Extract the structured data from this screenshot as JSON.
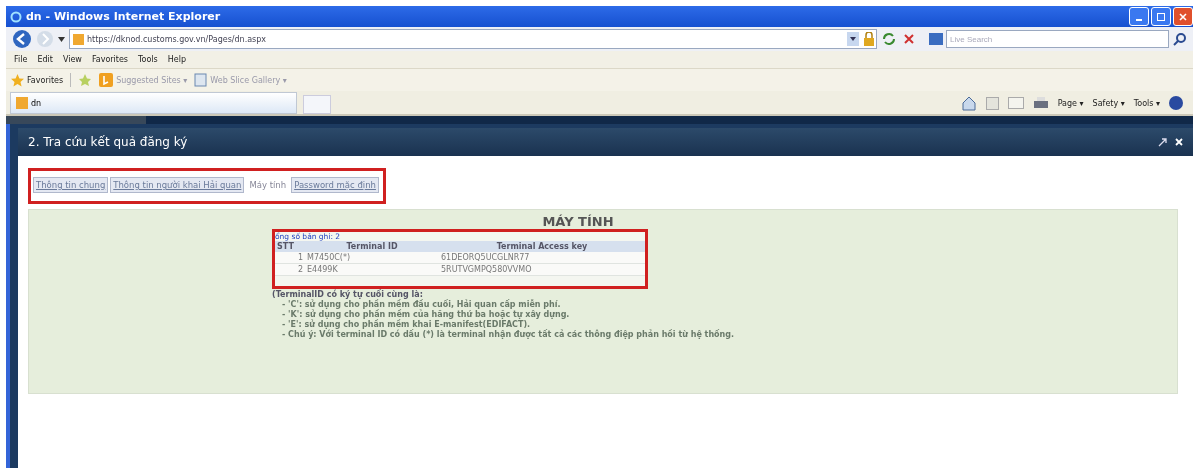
{
  "window": {
    "title": "dn - Windows Internet Explorer"
  },
  "address_bar": {
    "url": "https://dknod.customs.gov.vn/Pages/dn.aspx"
  },
  "search": {
    "placeholder": "Live Search"
  },
  "menu": [
    "File",
    "Edit",
    "View",
    "Favorites",
    "Tools",
    "Help"
  ],
  "favorites_bar": {
    "label": "Favorites",
    "links": [
      "Suggested Sites ▾",
      "Web Slice Gallery ▾"
    ]
  },
  "browser_tab": {
    "title": "dn"
  },
  "command_bar": [
    "Page ▾",
    "Safety ▾",
    "Tools ▾"
  ],
  "dialog": {
    "title": "2. Tra cứu kết quả đăng ký",
    "tabs": [
      {
        "label": "Thông tin chung",
        "selected": false
      },
      {
        "label": "Thông tin người khai Hải quan",
        "selected": false
      },
      {
        "label": "Máy tính",
        "selected": true
      },
      {
        "label": "Password mặc định",
        "selected": false
      }
    ],
    "section_title": "MÁY TÍNH",
    "record_count": "ổng số bản ghi: 2",
    "table": {
      "columns": [
        "STT",
        "Terminal ID",
        "Terminal Access key"
      ],
      "rows": [
        [
          "1",
          "M7450C(*)",
          "61DEORQ5UCGLNR77"
        ],
        [
          "2",
          "E4499K",
          "5RUTVGMPQ580VVMO"
        ]
      ]
    },
    "notes": [
      "(TerminalID có ký tự cuối cùng là:",
      "- 'C': sử dụng cho phần mềm đầu cuối, Hải quan cấp miễn phí.",
      "- 'K': sử dụng cho phần mềm của hãng thứ ba hoặc tự xây dựng.",
      "- 'E': sử dụng cho phần mềm khai E-manifest(EDIFACT).",
      "- Chú ý: Với terminal ID có dấu (*) là terminal nhận được tất cả các thông điệp phản hồi từ hệ thống."
    ]
  }
}
